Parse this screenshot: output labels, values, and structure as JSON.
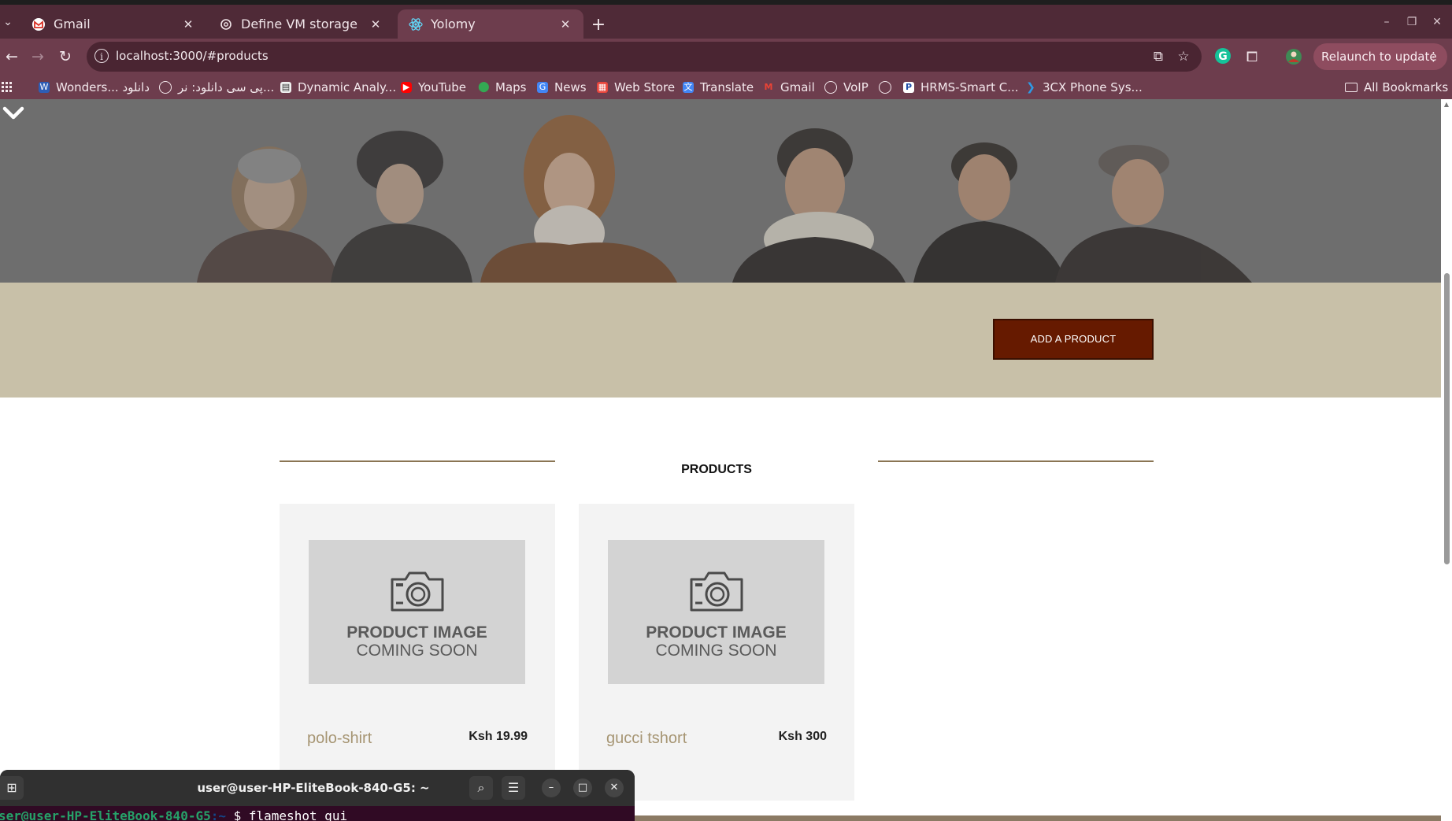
{
  "browser": {
    "tabs": [
      {
        "title": "Gmail",
        "icon": "gmail-icon",
        "active": false
      },
      {
        "title": "Define VM storage",
        "icon": "openai-icon",
        "active": false
      },
      {
        "title": "Yolomy",
        "icon": "react-icon",
        "active": true
      }
    ],
    "url": "localhost:3000/#products",
    "relaunch_label": "Relaunch to update",
    "bookmarks": [
      {
        "label": "Wonders... دانلود",
        "icon": "wonders-icon"
      },
      {
        "label": "پی سی دانلود: نر...",
        "icon": "globe-icon"
      },
      {
        "label": "Dynamic Analy...",
        "icon": "doc-icon"
      },
      {
        "label": "YouTube",
        "icon": "youtube-icon"
      },
      {
        "label": "Maps",
        "icon": "maps-icon"
      },
      {
        "label": "News",
        "icon": "news-icon"
      },
      {
        "label": "Web Store",
        "icon": "webstore-icon"
      },
      {
        "label": "Translate",
        "icon": "translate-icon"
      },
      {
        "label": "Gmail",
        "icon": "gmail-icon"
      },
      {
        "label": "VoIP",
        "icon": "globe-icon"
      },
      {
        "label": "",
        "icon": "globe-icon"
      },
      {
        "label": "HRMS-Smart C...",
        "icon": "hrms-icon"
      },
      {
        "label": "3CX Phone Sys...",
        "icon": "3cx-icon"
      }
    ],
    "all_bookmarks_label": "All Bookmarks"
  },
  "page": {
    "add_product_label": "ADD A PRODUCT",
    "section_title": "PRODUCTS",
    "products": [
      {
        "name": "polo-shirt",
        "price": "Ksh 19.99",
        "placeholder_line1": "PRODUCT IMAGE",
        "placeholder_line2": "COMING SOON"
      },
      {
        "name": "gucci tshort",
        "price": "Ksh 300",
        "placeholder_line1": "PRODUCT IMAGE",
        "placeholder_line2": "COMING SOON"
      }
    ]
  },
  "terminal": {
    "title": "user@user-HP-EliteBook-840-G5: ~",
    "prompt": "ser@user-HP-EliteBook-840-G5",
    "path": ":~",
    "command": "$ flameshot gui"
  },
  "colors": {
    "tabbar": "#4f2a37",
    "toolbar": "#6d3d4d",
    "relaunch": "#8e4c5f",
    "band": "#c8c0a8",
    "add_button": "#661a00",
    "rule": "#8a7553",
    "product_name": "#a69573",
    "card_bg": "#f3f3f3"
  }
}
